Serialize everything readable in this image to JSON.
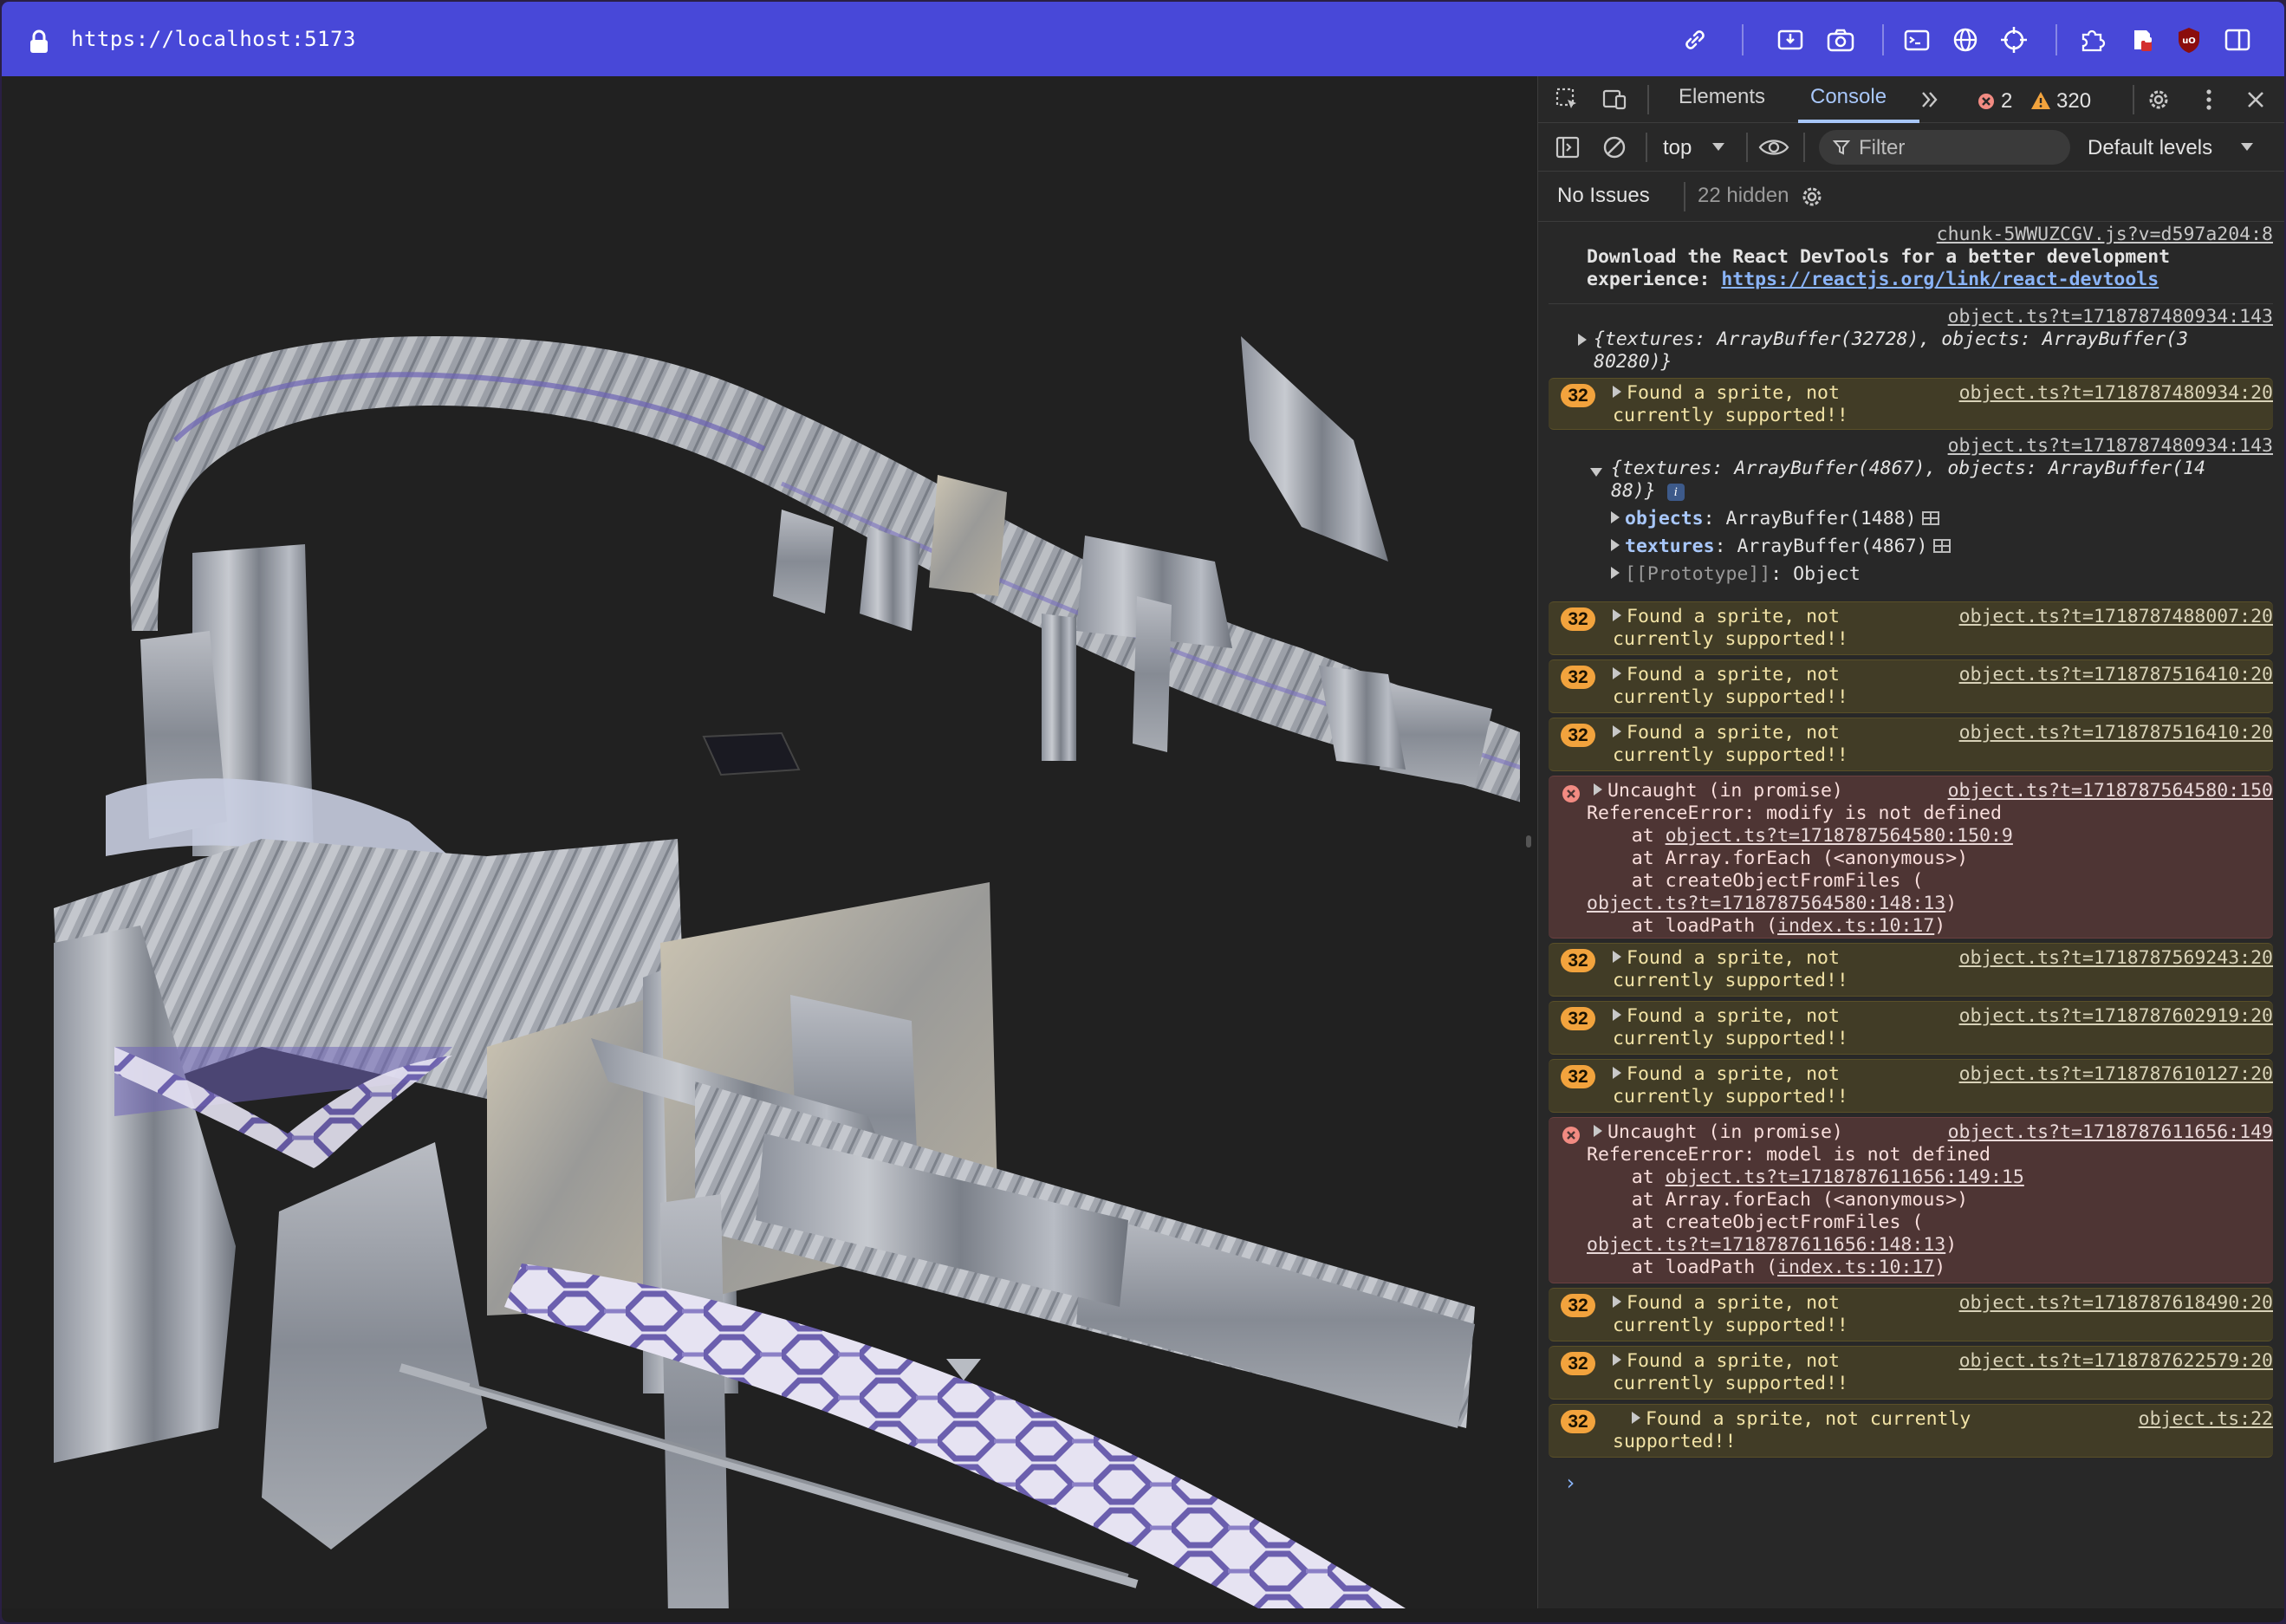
{
  "browser": {
    "url": "https://localhost:5173",
    "toolbar_icons": [
      "link-icon",
      "install-app-icon",
      "screenshot-camera-icon",
      "terminal-icon",
      "globe-icon",
      "crosshair-icon",
      "extensions-puzzle-icon",
      "shield-extension-icon",
      "ublock-icon",
      "sidebar-toggle-icon"
    ],
    "accent_color": "#4848d8"
  },
  "devtools": {
    "tabs": [
      {
        "label": "Elements",
        "active": false
      },
      {
        "label": "Console",
        "active": true
      }
    ],
    "error_count": "2",
    "warning_count": "320",
    "context_selector": "top",
    "filter_placeholder": "Filter",
    "levels_label": "Default levels",
    "issues_label": "No Issues",
    "hidden_label": "22 hidden"
  },
  "console": {
    "messages": [
      {
        "type": "log",
        "source": "chunk-5WWUZCGV.js?v=d597a204:8",
        "line1": "Download the React DevTools for a better development",
        "line2_prefix": "experience: ",
        "line2_link": "https://reactjs.org/link/react-devtools"
      },
      {
        "type": "log",
        "source": "object.ts?t=1718787480934:143",
        "obj_line1": "{textures: ArrayBuffer(32728), objects: ArrayBuffer(3",
        "obj_line2": "80280)}"
      },
      {
        "type": "warn",
        "count": "32",
        "text1": "Found a sprite, not",
        "text2": "currently supported!!",
        "source": "object.ts?t=1718787480934:20"
      },
      {
        "type": "log",
        "source": "object.ts?t=1718787480934:143",
        "obj_line1": "{textures: ArrayBuffer(4867), objects: ArrayBuffer(14",
        "obj_line2": "88)}",
        "props": [
          {
            "key": "objects",
            "value": "ArrayBuffer(1488)"
          },
          {
            "key": "textures",
            "value": "ArrayBuffer(4867)"
          },
          {
            "key": "[[Prototype]]",
            "value": "Object"
          }
        ]
      },
      {
        "type": "warn",
        "count": "32",
        "text1": "Found a sprite, not",
        "text2": "currently supported!!",
        "source": "object.ts?t=1718787488007:20"
      },
      {
        "type": "warn",
        "count": "32",
        "text1": "Found a sprite, not",
        "text2": "currently supported!!",
        "source": "object.ts?t=1718787516410:20"
      },
      {
        "type": "warn",
        "count": "32",
        "text1": "Found a sprite, not",
        "text2": "currently supported!!",
        "source": "object.ts?t=1718787516410:20"
      },
      {
        "type": "error",
        "head": "Uncaught (in promise)",
        "source": "object.ts?t=1718787564580:150",
        "message": "ReferenceError: modify is not defined",
        "stack": [
          {
            "prefix": "    at ",
            "link": "object.ts?t=1718787564580:150:9",
            "suffix": ""
          },
          {
            "prefix": "    at Array.forEach (<anonymous>)",
            "link": "",
            "suffix": ""
          },
          {
            "prefix": "    at createObjectFromFiles (",
            "link": "",
            "suffix": ""
          },
          {
            "prefix": "",
            "link": "object.ts?t=1718787564580:148:13",
            "suffix": ")"
          },
          {
            "prefix": "    at loadPath (",
            "link": "index.ts:10:17",
            "suffix": ")"
          }
        ]
      },
      {
        "type": "warn",
        "count": "32",
        "text1": "Found a sprite, not",
        "text2": "currently supported!!",
        "source": "object.ts?t=1718787569243:20"
      },
      {
        "type": "warn",
        "count": "32",
        "text1": "Found a sprite, not",
        "text2": "currently supported!!",
        "source": "object.ts?t=1718787602919:20"
      },
      {
        "type": "warn",
        "count": "32",
        "text1": "Found a sprite, not",
        "text2": "currently supported!!",
        "source": "object.ts?t=1718787610127:20"
      },
      {
        "type": "error",
        "head": "Uncaught (in promise)",
        "source": "object.ts?t=1718787611656:149",
        "message": "ReferenceError: model is not defined",
        "stack": [
          {
            "prefix": "    at ",
            "link": "object.ts?t=1718787611656:149:15",
            "suffix": ""
          },
          {
            "prefix": "    at Array.forEach (<anonymous>)",
            "link": "",
            "suffix": ""
          },
          {
            "prefix": "    at createObjectFromFiles (",
            "link": "",
            "suffix": ""
          },
          {
            "prefix": "",
            "link": "object.ts?t=1718787611656:148:13",
            "suffix": ")"
          },
          {
            "prefix": "    at loadPath (",
            "link": "index.ts:10:17",
            "suffix": ")"
          }
        ]
      },
      {
        "type": "warn",
        "count": "32",
        "text1": "Found a sprite, not",
        "text2": "currently supported!!",
        "source": "object.ts?t=1718787618490:20"
      },
      {
        "type": "warn",
        "count": "32",
        "text1": "Found a sprite, not",
        "text2": "currently supported!!",
        "source": "object.ts?t=1718787622579:20"
      },
      {
        "type": "warn",
        "count": "32",
        "text1": "Found a sprite, not currently",
        "text2": "supported!!",
        "source": "object.ts:22"
      }
    ],
    "prompt_symbol": "›"
  }
}
